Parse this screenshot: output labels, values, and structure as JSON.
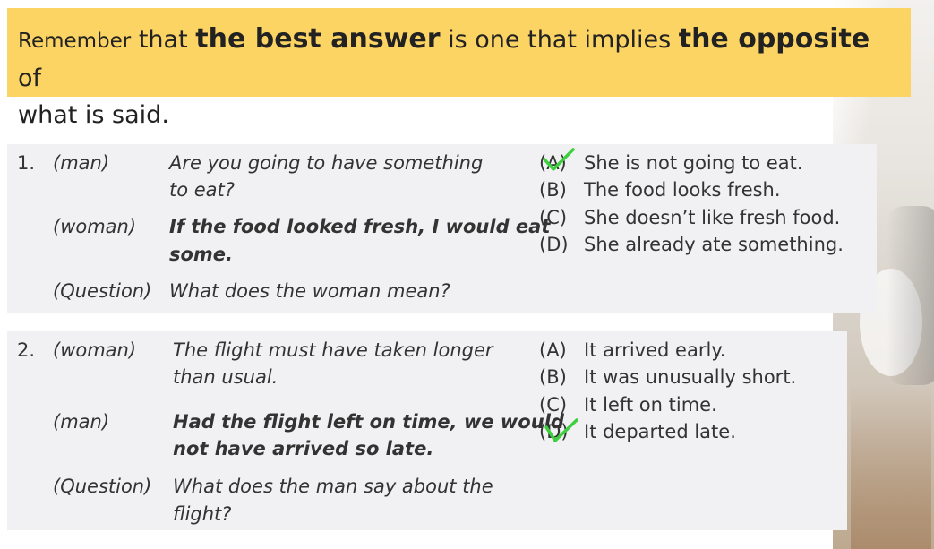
{
  "banner": {
    "w1": "Remember",
    "w2": " that ",
    "b1": "the best answer",
    "w3": " is one that implies ",
    "b2": "the opposite",
    "w4": " of",
    "w5": "what is said."
  },
  "questions": [
    {
      "number": "1.",
      "dialog": [
        {
          "speaker": "(man)",
          "lines": [
            "Are you going to have something",
            "to eat?"
          ]
        },
        {
          "speaker": "(woman)",
          "lines": [
            "If the food looked fresh, I would eat",
            "some."
          ]
        },
        {
          "speaker": "(Question)",
          "lines": [
            "What does the woman mean?"
          ]
        }
      ],
      "options": [
        {
          "letter": "(A)",
          "text": "She is not going to eat."
        },
        {
          "letter": "(B)",
          "text": "The food looks fresh."
        },
        {
          "letter": "(C)",
          "text": "She doesn’t like fresh food."
        },
        {
          "letter": "(D)",
          "text": "She already ate something."
        }
      ],
      "checked": "A"
    },
    {
      "number": "2.",
      "dialog": [
        {
          "speaker": "(woman)",
          "lines": [
            "The flight must have taken longer",
            "than usual."
          ]
        },
        {
          "speaker": "(man)",
          "lines": [
            "Had the flight left on time, we would",
            "not have arrived so late."
          ]
        },
        {
          "speaker": "(Question)",
          "lines": [
            "What does the man say about the",
            "flight?"
          ]
        }
      ],
      "options": [
        {
          "letter": "(A)",
          "text": "It arrived early."
        },
        {
          "letter": "(B)",
          "text": "It was unusually short."
        },
        {
          "letter": "(C)",
          "text": "It left on time."
        },
        {
          "letter": "(D)",
          "text": "It departed late."
        }
      ],
      "checked": "D"
    }
  ],
  "colors": {
    "banner": "#fcd464",
    "card": "#f1f1f3",
    "check": "#3ecf3e"
  }
}
